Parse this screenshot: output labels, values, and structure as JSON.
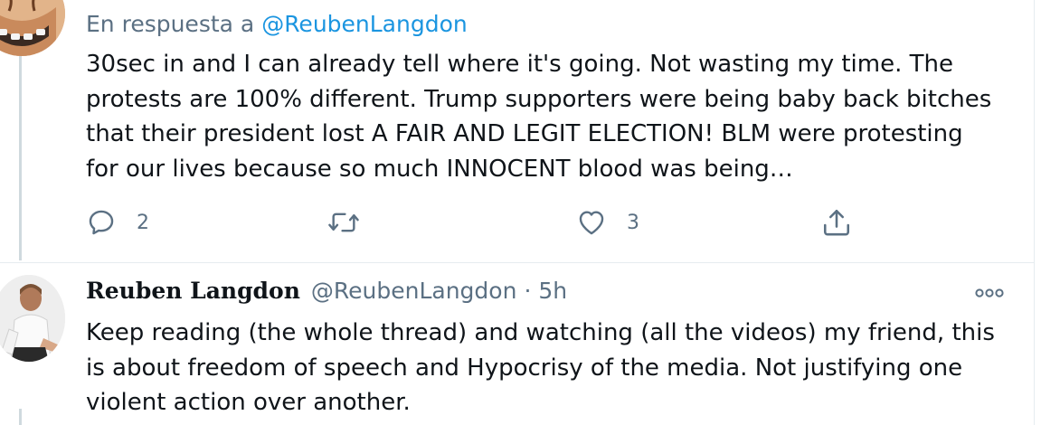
{
  "tweet_1": {
    "reply_prefix": "En respuesta a",
    "reply_mention": "@ReubenLangdon",
    "text_lines": [
      "30sec in and I can already tell where it's going. Not wasting my time. The",
      "protests are 100% different. Trump supporters were being baby back bitches",
      "that their president lost A FAIR AND LEGIT ELECTION! BLM were protesting",
      "for our lives because so much INNOCENT blood was being…"
    ],
    "actions": {
      "reply_count": "2",
      "retweet_count": "",
      "like_count": "3",
      "reply_icon": "reply-icon",
      "retweet_icon": "retweet-icon",
      "like_icon": "heart-icon",
      "share_icon": "share-icon"
    }
  },
  "tweet_2": {
    "author_name": "Reuben Langdon",
    "author_handle": "@ReubenLangdon",
    "separator": "·",
    "time": "5h",
    "more_icon": "more-icon",
    "text_lines": [
      "Keep reading (the whole thread) and watching (all the videos) my friend, this",
      "is about freedom of speech and Hypocrisy of the media. Not justifying one",
      "violent action over another."
    ]
  },
  "colors": {
    "text": "#0f1419",
    "secondary": "#5b7083",
    "mention": "#1b95e0",
    "thread_line": "#cfd9de",
    "divider": "#e6ecf0"
  }
}
